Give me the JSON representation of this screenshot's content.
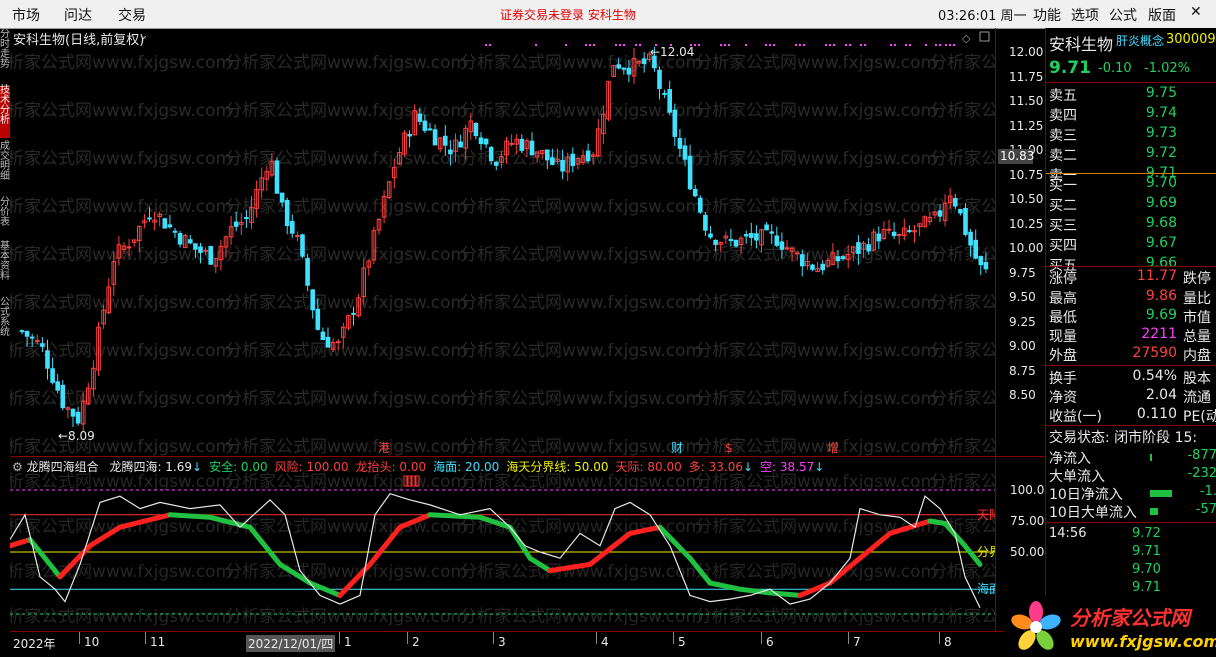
{
  "menu": {
    "left": [
      "市场",
      "问达",
      "交易"
    ],
    "right": [
      "功能",
      "选项",
      "公式",
      "版面"
    ],
    "notice": "证券交易未登录   安科生物",
    "clock": "03:26:01 周一"
  },
  "vtabs": [
    "分时走势",
    "技术分析",
    "成交明细",
    "分价表",
    "基本资料",
    "公式系统"
  ],
  "main": {
    "title": "安科生物(日线,前复权)",
    "high_label": "12.04",
    "low_label": "8.09",
    "current_price_tag": "10.83",
    "price_ticks": [
      "12.00",
      "11.75",
      "11.50",
      "11.25",
      "11.00",
      "10.75",
      "10.50",
      "10.25",
      "10.00",
      "9.75",
      "9.50",
      "9.25",
      "9.00",
      "8.75",
      "8.50"
    ],
    "event_tags": [
      "港",
      "财",
      "$",
      "增"
    ],
    "watermark": "分析家公式网www.fxjgsw.com"
  },
  "indicator": {
    "name": "龙腾四海组合",
    "items": [
      {
        "label": "龙腾四海: 1.69",
        "color": "#e8e8e8"
      },
      {
        "label": "安全: 0.00",
        "color": "#20d060"
      },
      {
        "label": "风险: 100.00",
        "color": "#ff4040"
      },
      {
        "label": "龙抬头: 0.00",
        "color": "#ff4040"
      },
      {
        "label": "海面: 20.00",
        "color": "#40e0ff"
      },
      {
        "label": "海天分界线: 50.00",
        "color": "#f0f000"
      },
      {
        "label": "天际: 80.00",
        "color": "#ff4040"
      },
      {
        "label": "多: 33.06",
        "color": "#ff4040"
      },
      {
        "label": "空: 38.57",
        "color": "#ff40ff"
      }
    ],
    "scale": [
      "100.0",
      "75.00",
      "50.00"
    ],
    "line_labels": [
      "天际",
      "分界",
      "海面"
    ]
  },
  "dates": [
    "2022年",
    "10",
    "11",
    "2022/12/01/四",
    "1",
    "2",
    "3",
    "4",
    "5",
    "6",
    "7",
    "8"
  ],
  "quote": {
    "name": "安科生物",
    "concept": "肝炎概念",
    "code": "300009",
    "price": "9.71",
    "change": "-0.10",
    "pct": "-1.02%",
    "asks": [
      [
        "卖五",
        "9.75"
      ],
      [
        "卖四",
        "9.74"
      ],
      [
        "卖三",
        "9.73"
      ],
      [
        "卖二",
        "9.72"
      ],
      [
        "卖一",
        "9.71"
      ]
    ],
    "bids": [
      [
        "买一",
        "9.70"
      ],
      [
        "买二",
        "9.69"
      ],
      [
        "买三",
        "9.68"
      ],
      [
        "买四",
        "9.67"
      ],
      [
        "买五",
        "9.66"
      ]
    ],
    "stats": [
      {
        "l": "涨停",
        "v": "11.77",
        "c": "red",
        "r": "跌停"
      },
      {
        "l": "最高",
        "v": "9.86",
        "c": "red",
        "r": "量比"
      },
      {
        "l": "最低",
        "v": "9.69",
        "c": "green",
        "r": "市值"
      },
      {
        "l": "现量",
        "v": "2211",
        "c": "mag",
        "r": "总量"
      },
      {
        "l": "外盘",
        "v": "27590",
        "c": "red",
        "r": "内盘"
      },
      {
        "l": "换手",
        "v": "0.54%",
        "c": "white",
        "r": "股本"
      },
      {
        "l": "净资",
        "v": "2.04",
        "c": "white",
        "r": "流通"
      },
      {
        "l": "收益(一)",
        "v": "0.110",
        "c": "white",
        "r": "PE(动)"
      }
    ],
    "trade_state": "交易状态: 闭市阶段 15:",
    "flows": [
      {
        "l": "净流入",
        "v": "-877"
      },
      {
        "l": "大单流入",
        "v": "-232"
      },
      {
        "l": "10日净流入",
        "v": "-1."
      },
      {
        "l": "10日大单流入",
        "v": "-57"
      }
    ],
    "ticks_time": "14:56",
    "ticks": [
      "9.72",
      "9.71",
      "9.70",
      "9.71"
    ]
  },
  "logo": {
    "title": "分析家公式网",
    "url": "www.fxjgsw.com"
  }
}
